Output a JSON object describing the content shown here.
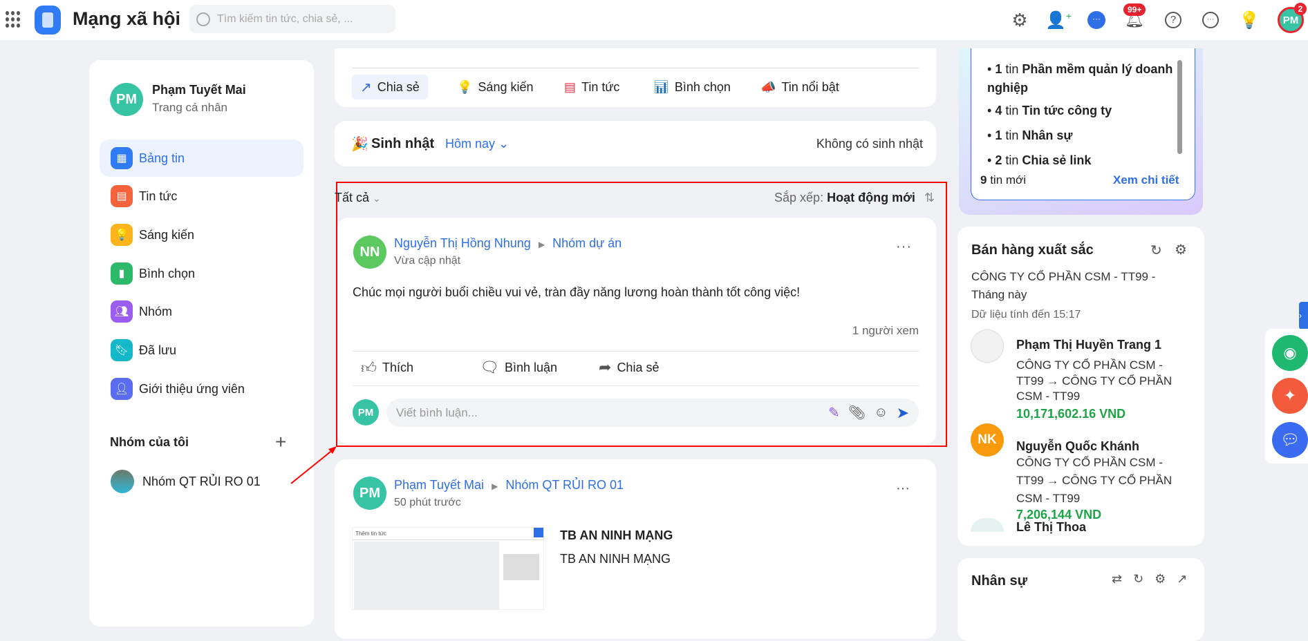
{
  "header": {
    "title": "Mạng xã hội",
    "search_placeholder": "Tìm kiếm tin tức, chia sẻ, ...",
    "notif_badge": "99+",
    "avatar_initials": "PM",
    "avatar_badge": "2"
  },
  "profile": {
    "initials": "PM",
    "name": "Phạm Tuyết Mai",
    "subtitle": "Trang cá nhân"
  },
  "sidebar": {
    "items": [
      {
        "label": "Bảng tin"
      },
      {
        "label": "Tin tức"
      },
      {
        "label": "Sáng kiến"
      },
      {
        "label": "Bình chọn"
      },
      {
        "label": "Nhóm"
      },
      {
        "label": "Đã lưu"
      },
      {
        "label": "Giới thiệu ứng viên"
      }
    ],
    "groups_title": "Nhóm của tôi",
    "groups": [
      {
        "name": "Nhóm QT RỦI RO 01"
      }
    ]
  },
  "composer": {
    "tabs": [
      {
        "label": "Chia sẻ"
      },
      {
        "label": "Sáng kiến"
      },
      {
        "label": "Tin tức"
      },
      {
        "label": "Bình chọn"
      },
      {
        "label": "Tin nổi bật"
      }
    ]
  },
  "birthday": {
    "title": "Sinh nhật",
    "filter": "Hôm nay",
    "empty": "Không có sinh nhật"
  },
  "feed": {
    "filter": "Tất cả",
    "sort_label": "Sắp xếp:",
    "sort_value": "Hoạt động mới"
  },
  "posts": [
    {
      "initials": "NN",
      "author": "Nguyễn Thị Hồng Nhung",
      "group": "Nhóm dự án",
      "time": "Vừa cập nhật",
      "content": "Chúc mọi người buổi chiều vui vẻ, tràn đầy năng lương hoàn thành tốt công việc!",
      "views": "1 người xem",
      "like": "Thích",
      "comment": "Bình luận",
      "share": "Chia sẻ",
      "comment_placeholder": "Viết bình luận...",
      "commenter_initials": "PM"
    },
    {
      "initials": "PM",
      "author": "Phạm Tuyết Mai",
      "group": "Nhóm QT RỦI RO 01",
      "time": "50 phút trước",
      "headline": "TB AN NINH MẠNG",
      "body": "TB AN NINH MẠNG",
      "thumb_title": "Thêm tin tức"
    }
  ],
  "news_summary": {
    "items": [
      {
        "count": "1",
        "unit": "tin",
        "topic": "Phần mềm quản lý doanh nghiệp"
      },
      {
        "count": "4",
        "unit": "tin",
        "topic": "Tin tức công ty"
      },
      {
        "count": "1",
        "unit": "tin",
        "topic": "Nhân sự"
      },
      {
        "count": "2",
        "unit": "tin",
        "topic": "Chia sẻ link"
      }
    ],
    "total": "9",
    "total_label": "tin mới",
    "detail_link": "Xem chi tiết"
  },
  "sales": {
    "title": "Bán hàng xuất sắc",
    "scope": "CÔNG TY CỔ PHẦN CSM - TT99 - Tháng này",
    "updated": "Dữ liệu tính đến 15:17",
    "people": [
      {
        "name": "Phạm Thị Huyền Trang 1",
        "org1": "CÔNG TY CỔ PHẦN CSM -",
        "org2": "TT99 → CÔNG TY CỔ PHẦN",
        "org3": "CSM - TT99",
        "amount": "10,171,602.16 VND"
      },
      {
        "initials": "NK",
        "name": "Nguyễn Quốc Khánh",
        "org1": "CÔNG TY CỔ PHẦN CSM -",
        "org2": "TT99 → CÔNG TY CỔ PHẦN",
        "org3": "CSM - TT99",
        "amount": "7,206,144 VND"
      },
      {
        "name": "Lê Thị Thoa"
      }
    ]
  },
  "hr": {
    "title": "Nhân sự"
  },
  "colors": {
    "accent": "#2f6fe6",
    "amount": "#1ea446",
    "highlight": "#ff0000"
  }
}
